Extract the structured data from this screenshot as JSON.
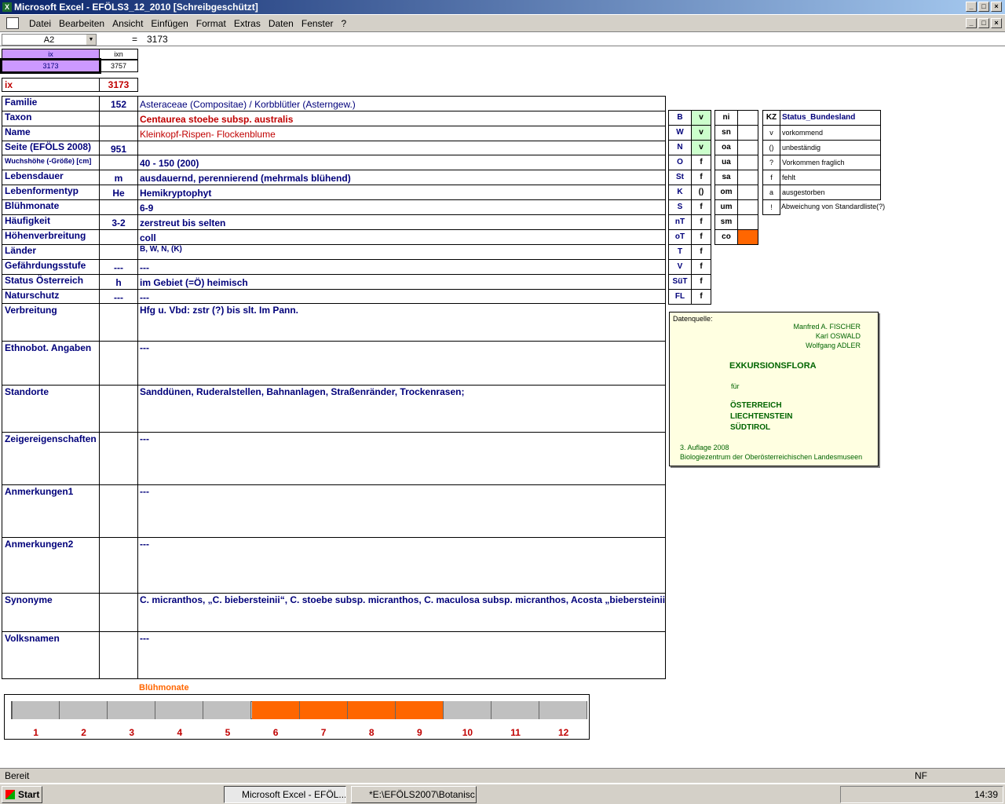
{
  "window": {
    "title": "Microsoft Excel - EFÖLS3_12_2010  [Schreibgeschützt]"
  },
  "menu": [
    "Datei",
    "Bearbeiten",
    "Ansicht",
    "Einfügen",
    "Format",
    "Extras",
    "Daten",
    "Fenster",
    "?"
  ],
  "formula": {
    "cell_ref": "A2",
    "eq": "=",
    "value": "3173"
  },
  "index_box": {
    "ix_label": "ix",
    "ixn_label": "ixn",
    "ix_value": "3173",
    "ixn_value": "3757"
  },
  "ix_row": {
    "label": "ix",
    "value": "3173"
  },
  "rows": [
    {
      "label": "Familie",
      "code": "152",
      "value": "Asteraceae (Compositae)  /  Korbblütler (Asterngew.)"
    },
    {
      "label": "Taxon",
      "code": "",
      "value": "Centaurea stoebe subsp. australis"
    },
    {
      "label": "Name",
      "code": "",
      "value": "Kleinkopf-Rispen- Flockenblume"
    },
    {
      "label": "Seite (EFÖLS 2008)",
      "code": "951",
      "value": ""
    },
    {
      "label": "Wuchshöhe (-Größe) [cm]",
      "code": "",
      "value": "40 - 150 (200)"
    },
    {
      "label": "Lebensdauer",
      "code": "m",
      "value": "ausdauernd, perennierend (mehrmals blühend)"
    },
    {
      "label": "Lebenformentyp",
      "code": "He",
      "value": "Hemikryptophyt"
    },
    {
      "label": "Blühmonate",
      "code": "",
      "value": "6-9"
    },
    {
      "label": "Häufigkeit",
      "code": "3-2",
      "value": "zerstreut bis selten"
    },
    {
      "label": "Höhenverbreitung",
      "code": "",
      "value": "coll"
    },
    {
      "label": "Länder",
      "code": "",
      "value": "B, W, N, (K)"
    },
    {
      "label": "Gefährdungsstufe",
      "code": "---",
      "value": "---"
    },
    {
      "label": "Status Österreich",
      "code": "h",
      "value": "im Gebiet (=Ö) heimisch"
    },
    {
      "label": "Naturschutz",
      "code": "---",
      "value": "---"
    }
  ],
  "tall_rows": [
    {
      "label": "Verbreitung",
      "value": "Hfg u. Vbd: zstr (?) bis slt. Im Pann."
    },
    {
      "label": "Ethnobot. Angaben",
      "value": "---"
    },
    {
      "label": "Standorte",
      "value": "Sanddünen, Ruderalstellen, Bahnanlagen, Straßenränder, Trockenrasen;"
    },
    {
      "label": "Zeigereigenschaften",
      "value": "---"
    },
    {
      "label": "Anmerkungen1",
      "value": "---"
    },
    {
      "label": "Anmerkungen2",
      "value": "---"
    },
    {
      "label": "Synonyme",
      "value": "C. micranthos, „C. biebersteinii“, C. stoebe subsp. micranthos, C. maculosa subsp. micranthos, Acosta „biebersteinii“"
    },
    {
      "label": "Volksnamen",
      "value": "---"
    }
  ],
  "states": [
    {
      "code": "B",
      "status": "v"
    },
    {
      "code": "W",
      "status": "v"
    },
    {
      "code": "N",
      "status": "v"
    },
    {
      "code": "O",
      "status": "f"
    },
    {
      "code": "St",
      "status": "f"
    },
    {
      "code": "K",
      "status": "()"
    },
    {
      "code": "S",
      "status": "f"
    },
    {
      "code": "nT",
      "status": "f"
    },
    {
      "code": "oT",
      "status": "f"
    },
    {
      "code": "T",
      "status": "f"
    },
    {
      "code": "V",
      "status": "f"
    },
    {
      "code": "SüT",
      "status": "f"
    },
    {
      "code": "FL",
      "status": "f"
    }
  ],
  "altitudes": [
    "ni",
    "sn",
    "oa",
    "ua",
    "sa",
    "om",
    "um",
    "sm",
    "co"
  ],
  "legend": {
    "header_code": "KZ",
    "header_label": "Status_Bundesland",
    "items": [
      {
        "code": "v",
        "label": "vorkommend"
      },
      {
        "code": "()",
        "label": "unbeständig"
      },
      {
        "code": "?",
        "label": "Vorkommen fraglich"
      },
      {
        "code": "f",
        "label": "fehlt"
      },
      {
        "code": "a",
        "label": "ausgestorben"
      },
      {
        "code": "!",
        "label": "Abweichung von Standardliste(?)"
      }
    ]
  },
  "source": {
    "heading": "Datenquelle:",
    "authors": [
      "Manfred A. FISCHER",
      "Karl OSWALD",
      "Wolfgang ADLER"
    ],
    "book": "EXKURSIONSFLORA",
    "fuer": "für",
    "countries": [
      "ÖSTERREICH",
      "LIECHTENSTEIN",
      "SÜDTIROL"
    ],
    "edition": "3. Auflage 2008",
    "publisher": "Biologiezentrum der Oberösterreichischen Landesmuseen"
  },
  "bloom": {
    "title": "Blühmonate",
    "months": [
      "1",
      "2",
      "3",
      "4",
      "5",
      "6",
      "7",
      "8",
      "9",
      "10",
      "11",
      "12"
    ],
    "active": [
      6,
      7,
      8,
      9
    ]
  },
  "colors": {
    "highlight": "#ff6600",
    "green_cell": "#ccffcc",
    "purple_cell": "#cc99ff",
    "note_bg": "#ffffe1"
  },
  "statusbar": {
    "text": "Bereit",
    "nf": "NF"
  },
  "taskbar": {
    "start": "Start",
    "tasks": [
      "Microsoft Excel - EFÖL...",
      "*E:\\EFÖLS2007\\Botanisc..."
    ],
    "clock": "14:39"
  }
}
